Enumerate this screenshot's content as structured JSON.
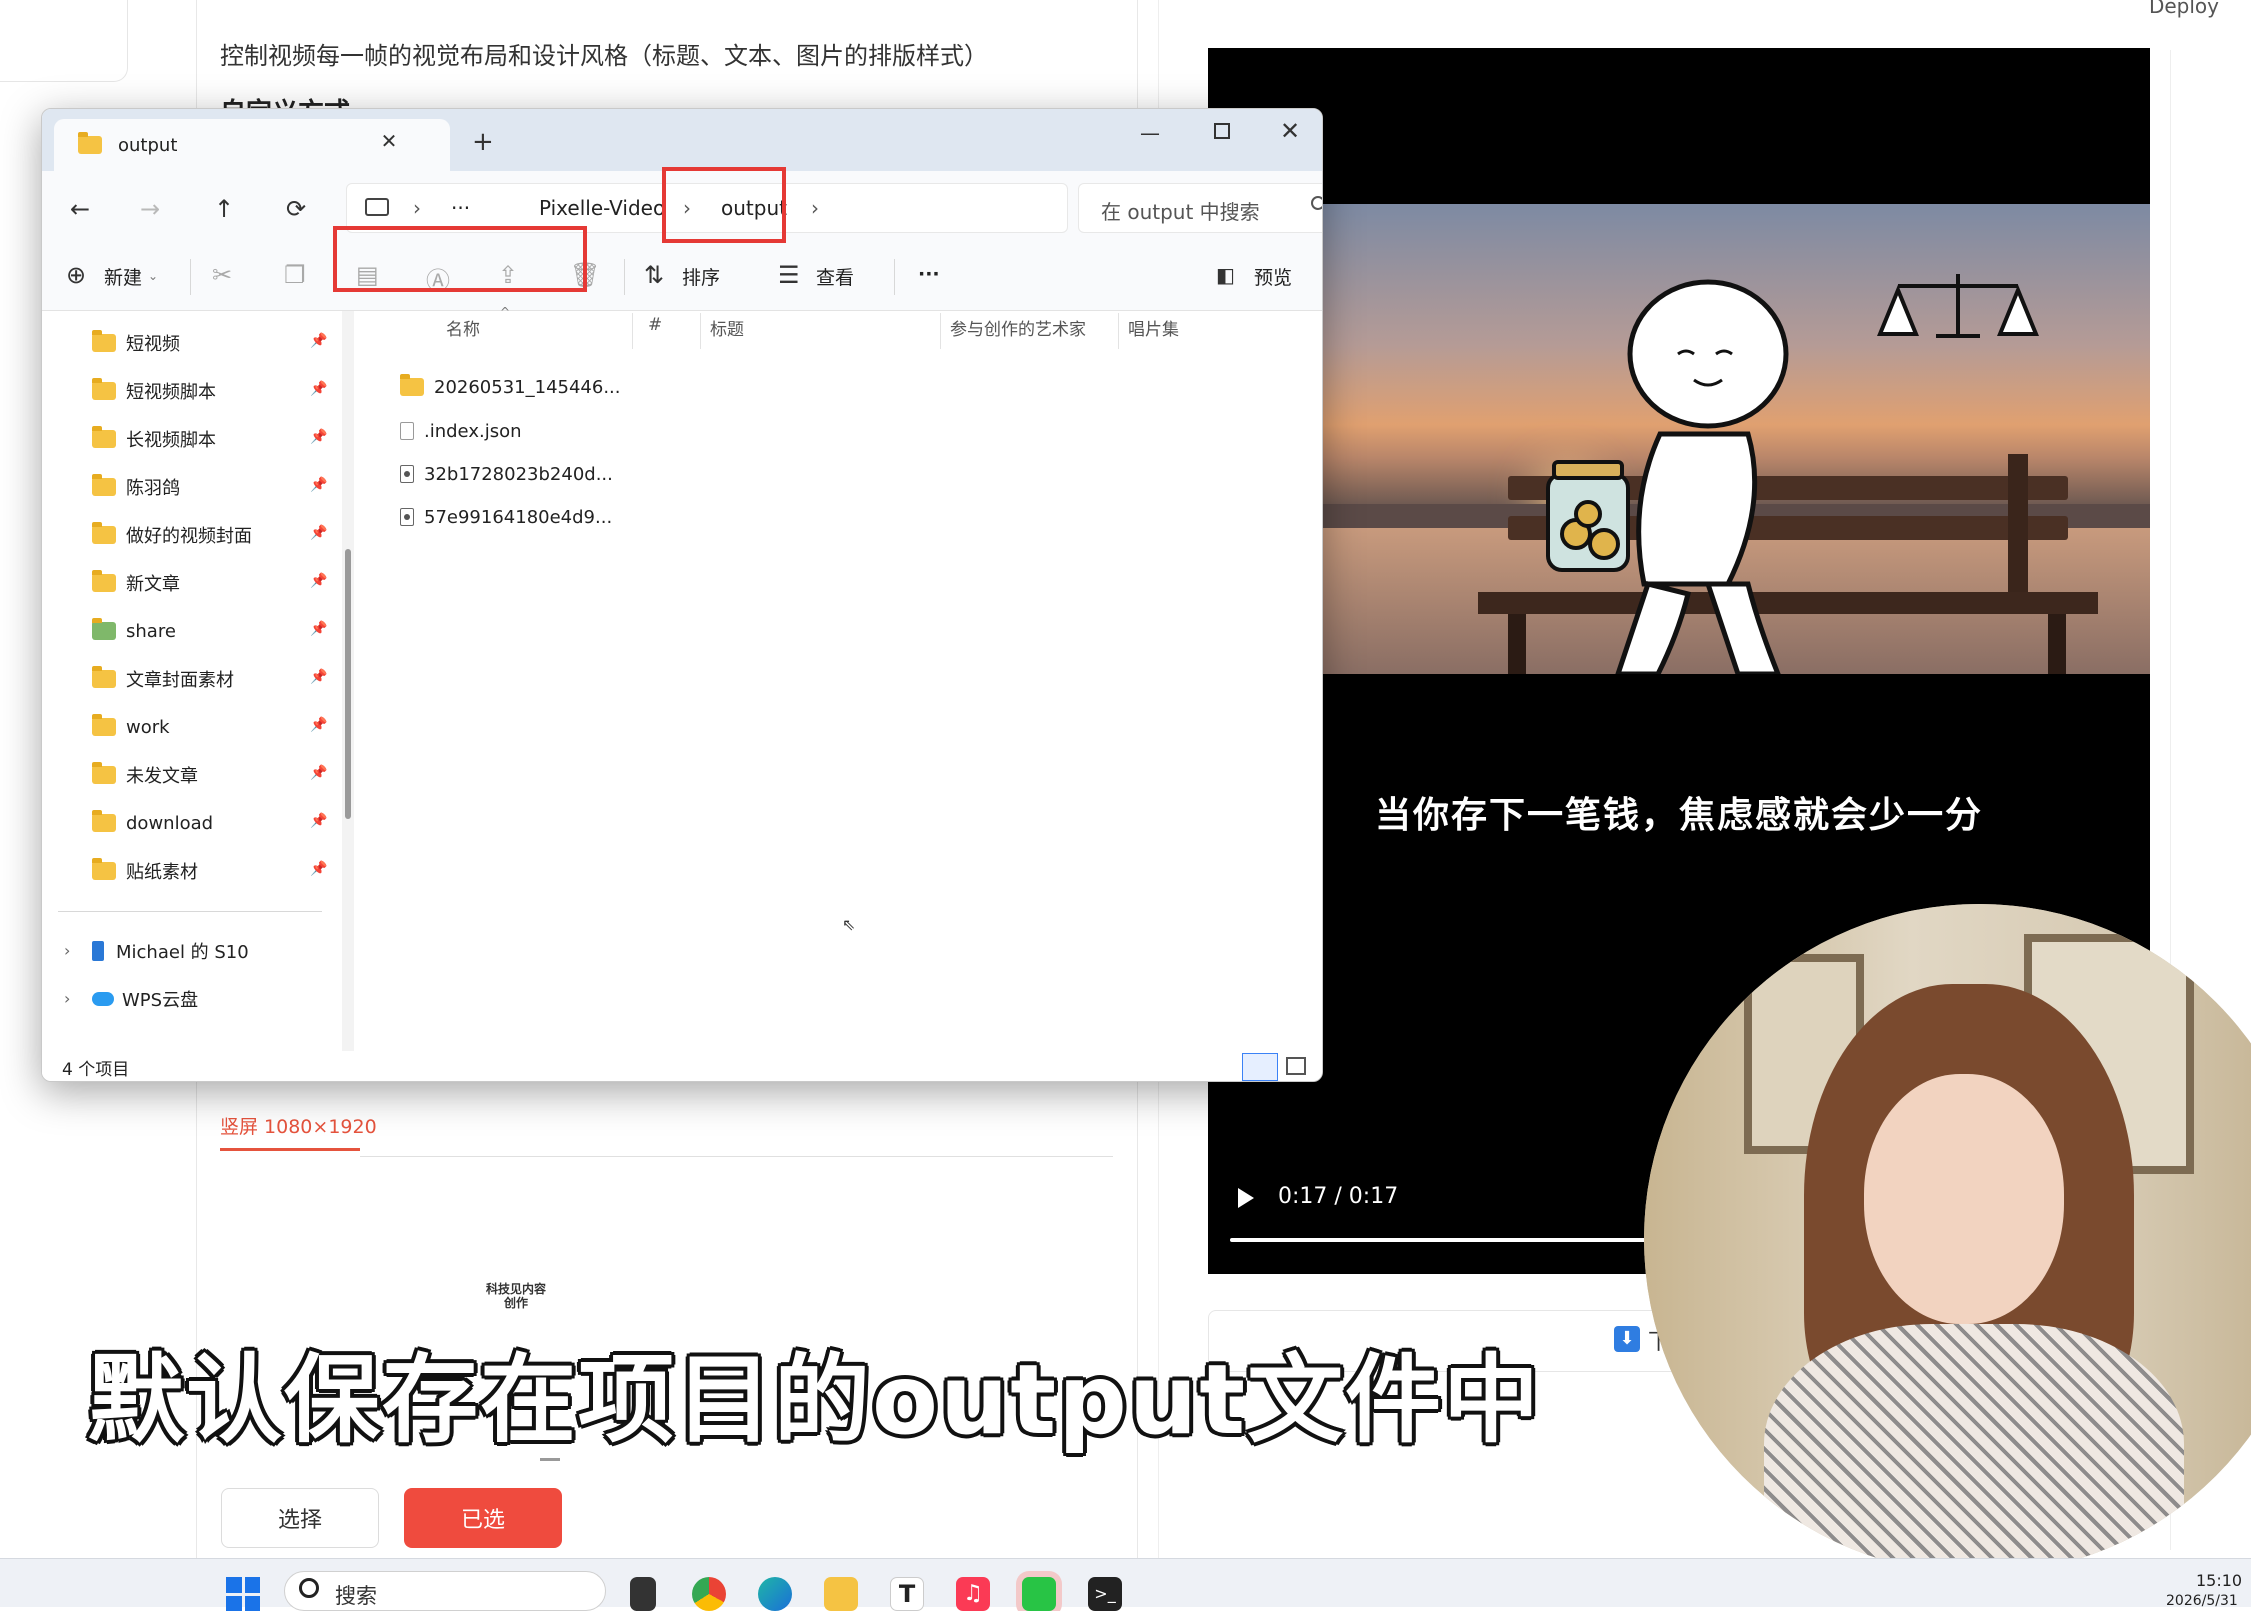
{
  "page": {
    "deploy_label": "Deploy",
    "line1": "控制视频每一帧的视觉布局和设计风格（标题、文本、图片的排版样式）",
    "line2": "自定义方式",
    "tab_label": "竖屏 1080×1920",
    "logo_text": "科技见内容 创作",
    "select_button": "选择",
    "selected_button": "已选",
    "download_label": "下载",
    "accent_color": "#ef4b3e"
  },
  "video": {
    "caption": "当你存下一笔钱，焦虑感就会少一分",
    "time": "0:17 / 0:17",
    "progress": 1.0
  },
  "overlay": {
    "subtitle": "默认保存在项目的output文件中"
  },
  "explorer": {
    "tab_title": "output",
    "tab_close": "✕",
    "tab_add": "+",
    "nav": {
      "back": "←",
      "forward": "→",
      "up": "↑",
      "refresh": "⟳"
    },
    "breadcrumb": {
      "more": "···",
      "items": [
        "Pixelle-Video",
        "output"
      ],
      "sep": "›"
    },
    "search_placeholder": "在 output 中搜索",
    "toolbar": {
      "new_label": "新建",
      "sort_label": "排序",
      "view_label": "查看",
      "more": "···",
      "preview_label": "预览"
    },
    "sidebar": {
      "items": [
        {
          "label": "短视频"
        },
        {
          "label": "短视频脚本"
        },
        {
          "label": "长视频脚本"
        },
        {
          "label": "陈羽鸽"
        },
        {
          "label": "做好的视频封面"
        },
        {
          "label": "新文章"
        },
        {
          "label": "share"
        },
        {
          "label": "文章封面素材"
        },
        {
          "label": "work"
        },
        {
          "label": "未发文章"
        },
        {
          "label": "download"
        },
        {
          "label": "贴纸素材"
        }
      ],
      "devices": [
        {
          "label": "Michael 的 S10"
        },
        {
          "label": "WPS云盘"
        }
      ]
    },
    "columns": [
      "名称",
      "#",
      "标题",
      "参与创作的艺术家",
      "唱片集"
    ],
    "files": [
      {
        "name": "20260531_145446...",
        "type": "folder"
      },
      {
        "name": ".index.json",
        "type": "json"
      },
      {
        "name": "32b1728023b240d...",
        "type": "media"
      },
      {
        "name": "57e99164180e4d9...",
        "type": "media"
      }
    ],
    "status": "4 个项目"
  },
  "taskbar": {
    "search_label": "搜索",
    "time": "15:10",
    "date": "2026/5/31"
  }
}
